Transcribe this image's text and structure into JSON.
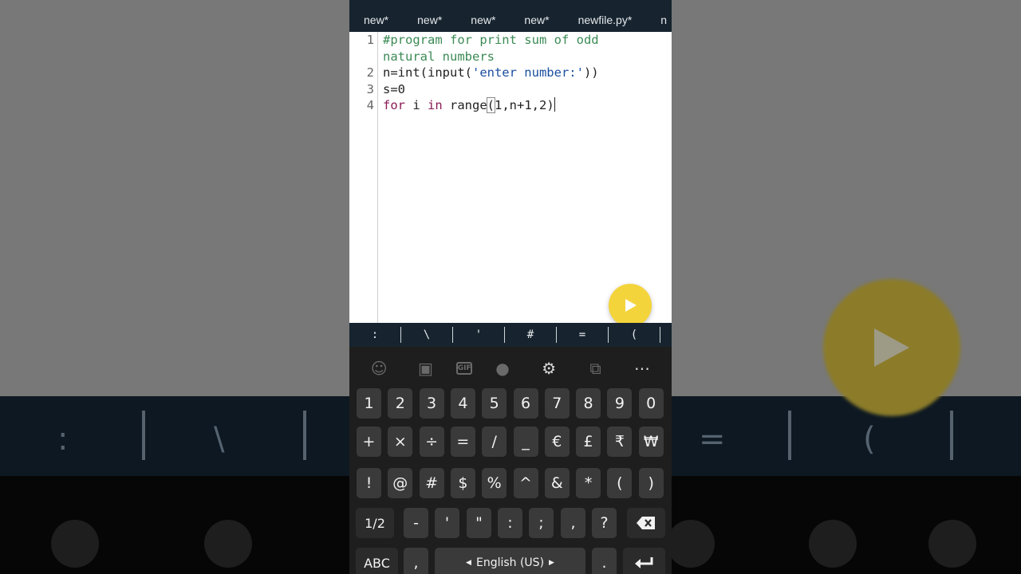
{
  "tabs": [
    "new*",
    "new*",
    "new*",
    "new*",
    "newfile.py*",
    "n"
  ],
  "editor": {
    "line_numbers": [
      "1",
      "2",
      "3",
      "4"
    ],
    "lines": {
      "l1a": "#program for print sum of odd",
      "l1b": "natural numbers",
      "l2_pre": "n=int(input(",
      "l2_str": "'enter number:'",
      "l2_post": "))",
      "l3": "s=0",
      "l4_kw1": "for",
      "l4_var": " i ",
      "l4_kw2": "in",
      "l4_mid": " range",
      "l4_paren": "(",
      "l4_args": "1,n+1,2)"
    }
  },
  "symbol_bar": [
    ":",
    "\\",
    "'",
    "#",
    "=",
    "("
  ],
  "keyboard": {
    "toolbar": [
      "emoji-icon",
      "sticker-icon",
      "gif-icon",
      "mic-icon",
      "gear-icon",
      "translate-icon",
      "more-icon"
    ],
    "gif_label": "GIF",
    "row1": [
      "1",
      "2",
      "3",
      "4",
      "5",
      "6",
      "7",
      "8",
      "9",
      "0"
    ],
    "row2": [
      "+",
      "×",
      "÷",
      "=",
      "/",
      "_",
      "€",
      "£",
      "₹",
      "₩"
    ],
    "row3": [
      "!",
      "@",
      "#",
      "$",
      "%",
      "^",
      "&",
      "*",
      "(",
      ")"
    ],
    "row4": [
      "1/2",
      "-",
      "'",
      "\"",
      ":",
      ";",
      ",",
      "?"
    ],
    "abc": "ABC",
    "comma": ",",
    "space_label": "English (US)",
    "period": ".",
    "accent": "#f4d43b"
  }
}
